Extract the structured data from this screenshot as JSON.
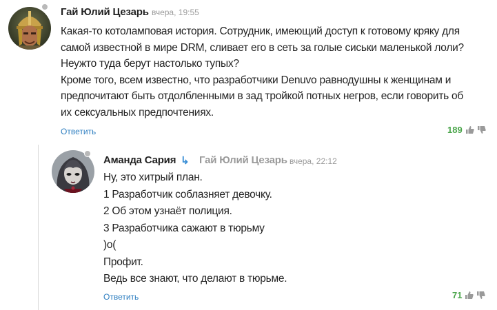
{
  "comments": [
    {
      "author": "Гай Юлий Цезарь",
      "time": "вчера, 19:55",
      "lines": [
        "Какая-то котоламповая история. Сотрудник, имеющий доступ к готовому кряку для",
        "самой известной в мире DRM, сливает его в сеть за голые сиськи маленькой лоли?",
        "Неужто туда берут настолько тупых?",
        "Кроме того, всем известно, что разработчики Denuvo равнодушны к женщинам и",
        "предпочитают быть отдолбленными в зад тройкой потных негров, если говорить об",
        "их сексуальных предпочтениях."
      ],
      "reply_label": "Ответить",
      "score": "189",
      "avatar_icon": "roman-soldier-avatar",
      "score_color": "#4aa54a"
    },
    {
      "author": "Аманда Сария",
      "reply_arrow": "↳",
      "reply_to": "Гай Юлий Цезарь",
      "time": "вчера, 22:12",
      "lines": [
        "Ну, это хитрый план.",
        "1 Разработчик соблазняет девочку.",
        "2 Об этом узнаёт полиция.",
        "3 Разработчика сажают в тюрьму",
        ")o(",
        "Профит.",
        "Ведь все знают, что делают в тюрьме."
      ],
      "reply_label": "Ответить",
      "score": "71",
      "avatar_icon": "dark-haired-woman-avatar",
      "score_color": "#4aa54a"
    }
  ]
}
